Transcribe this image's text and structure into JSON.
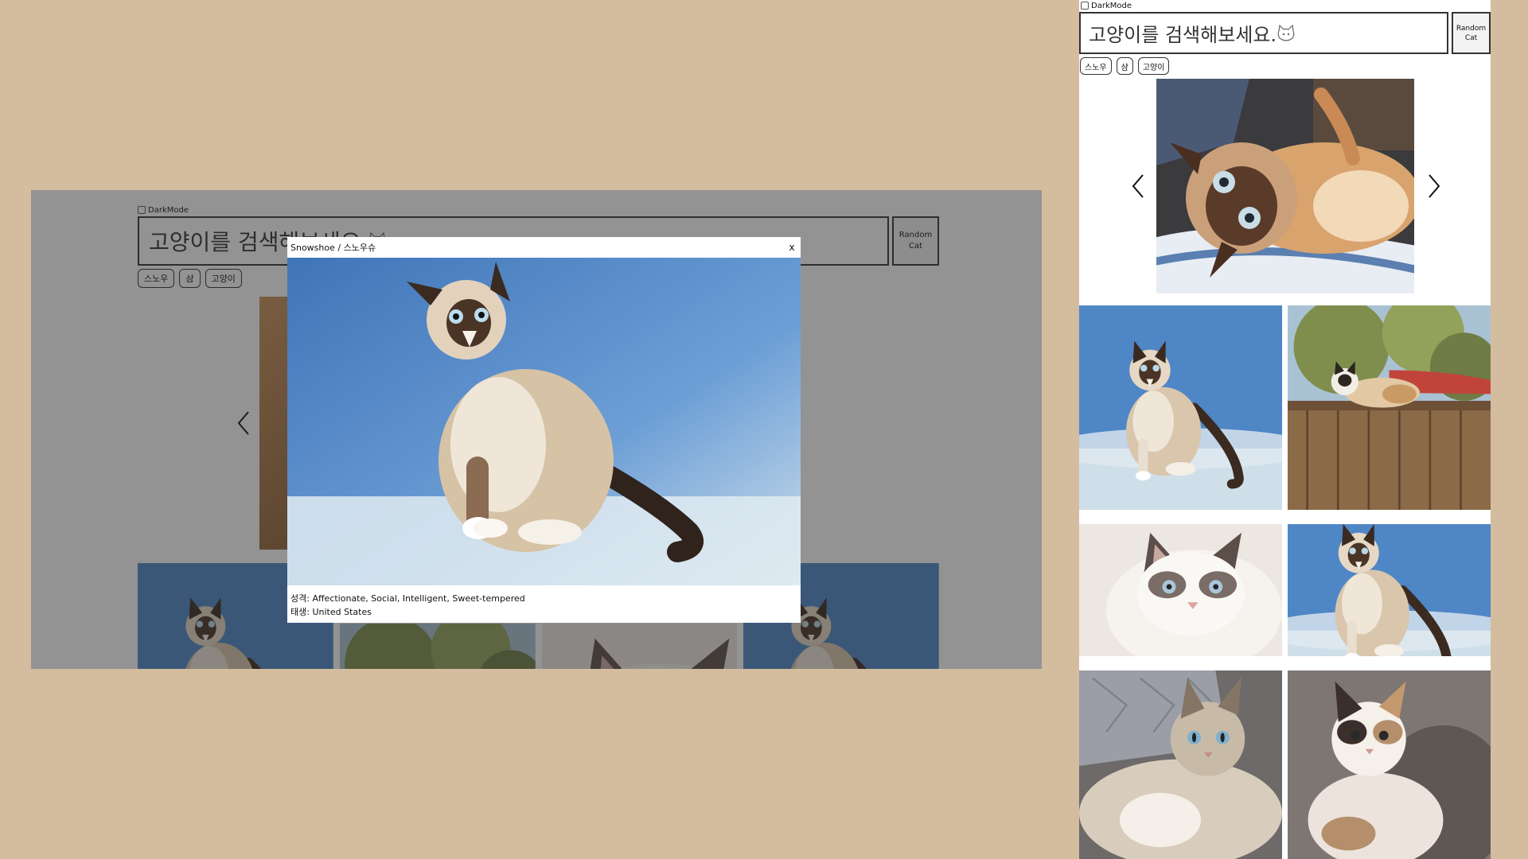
{
  "app": {
    "darkmode_label": "DarkMode",
    "search_placeholder": "고양이를 검색해보세요.",
    "random_button_line1": "Random",
    "random_button_line2": "Cat",
    "keywords": [
      "스노우",
      "샴",
      "고양이"
    ]
  },
  "modal": {
    "title": "Snowshoe / 스노우슈",
    "close_label": "x",
    "temperament_label": "성격",
    "temperament": "Affectionate, Social, Intelligent, Sweet-tempered",
    "origin_label": "태생",
    "origin": "United States"
  },
  "icons": {
    "prev": "chevron-left-icon",
    "next": "chevron-right-icon",
    "search_cat": "cat-face-icon"
  },
  "colors": {
    "page_background": "#d4bc9f",
    "overlay": "rgba(40,40,40,0.5)",
    "border": "#333333"
  }
}
